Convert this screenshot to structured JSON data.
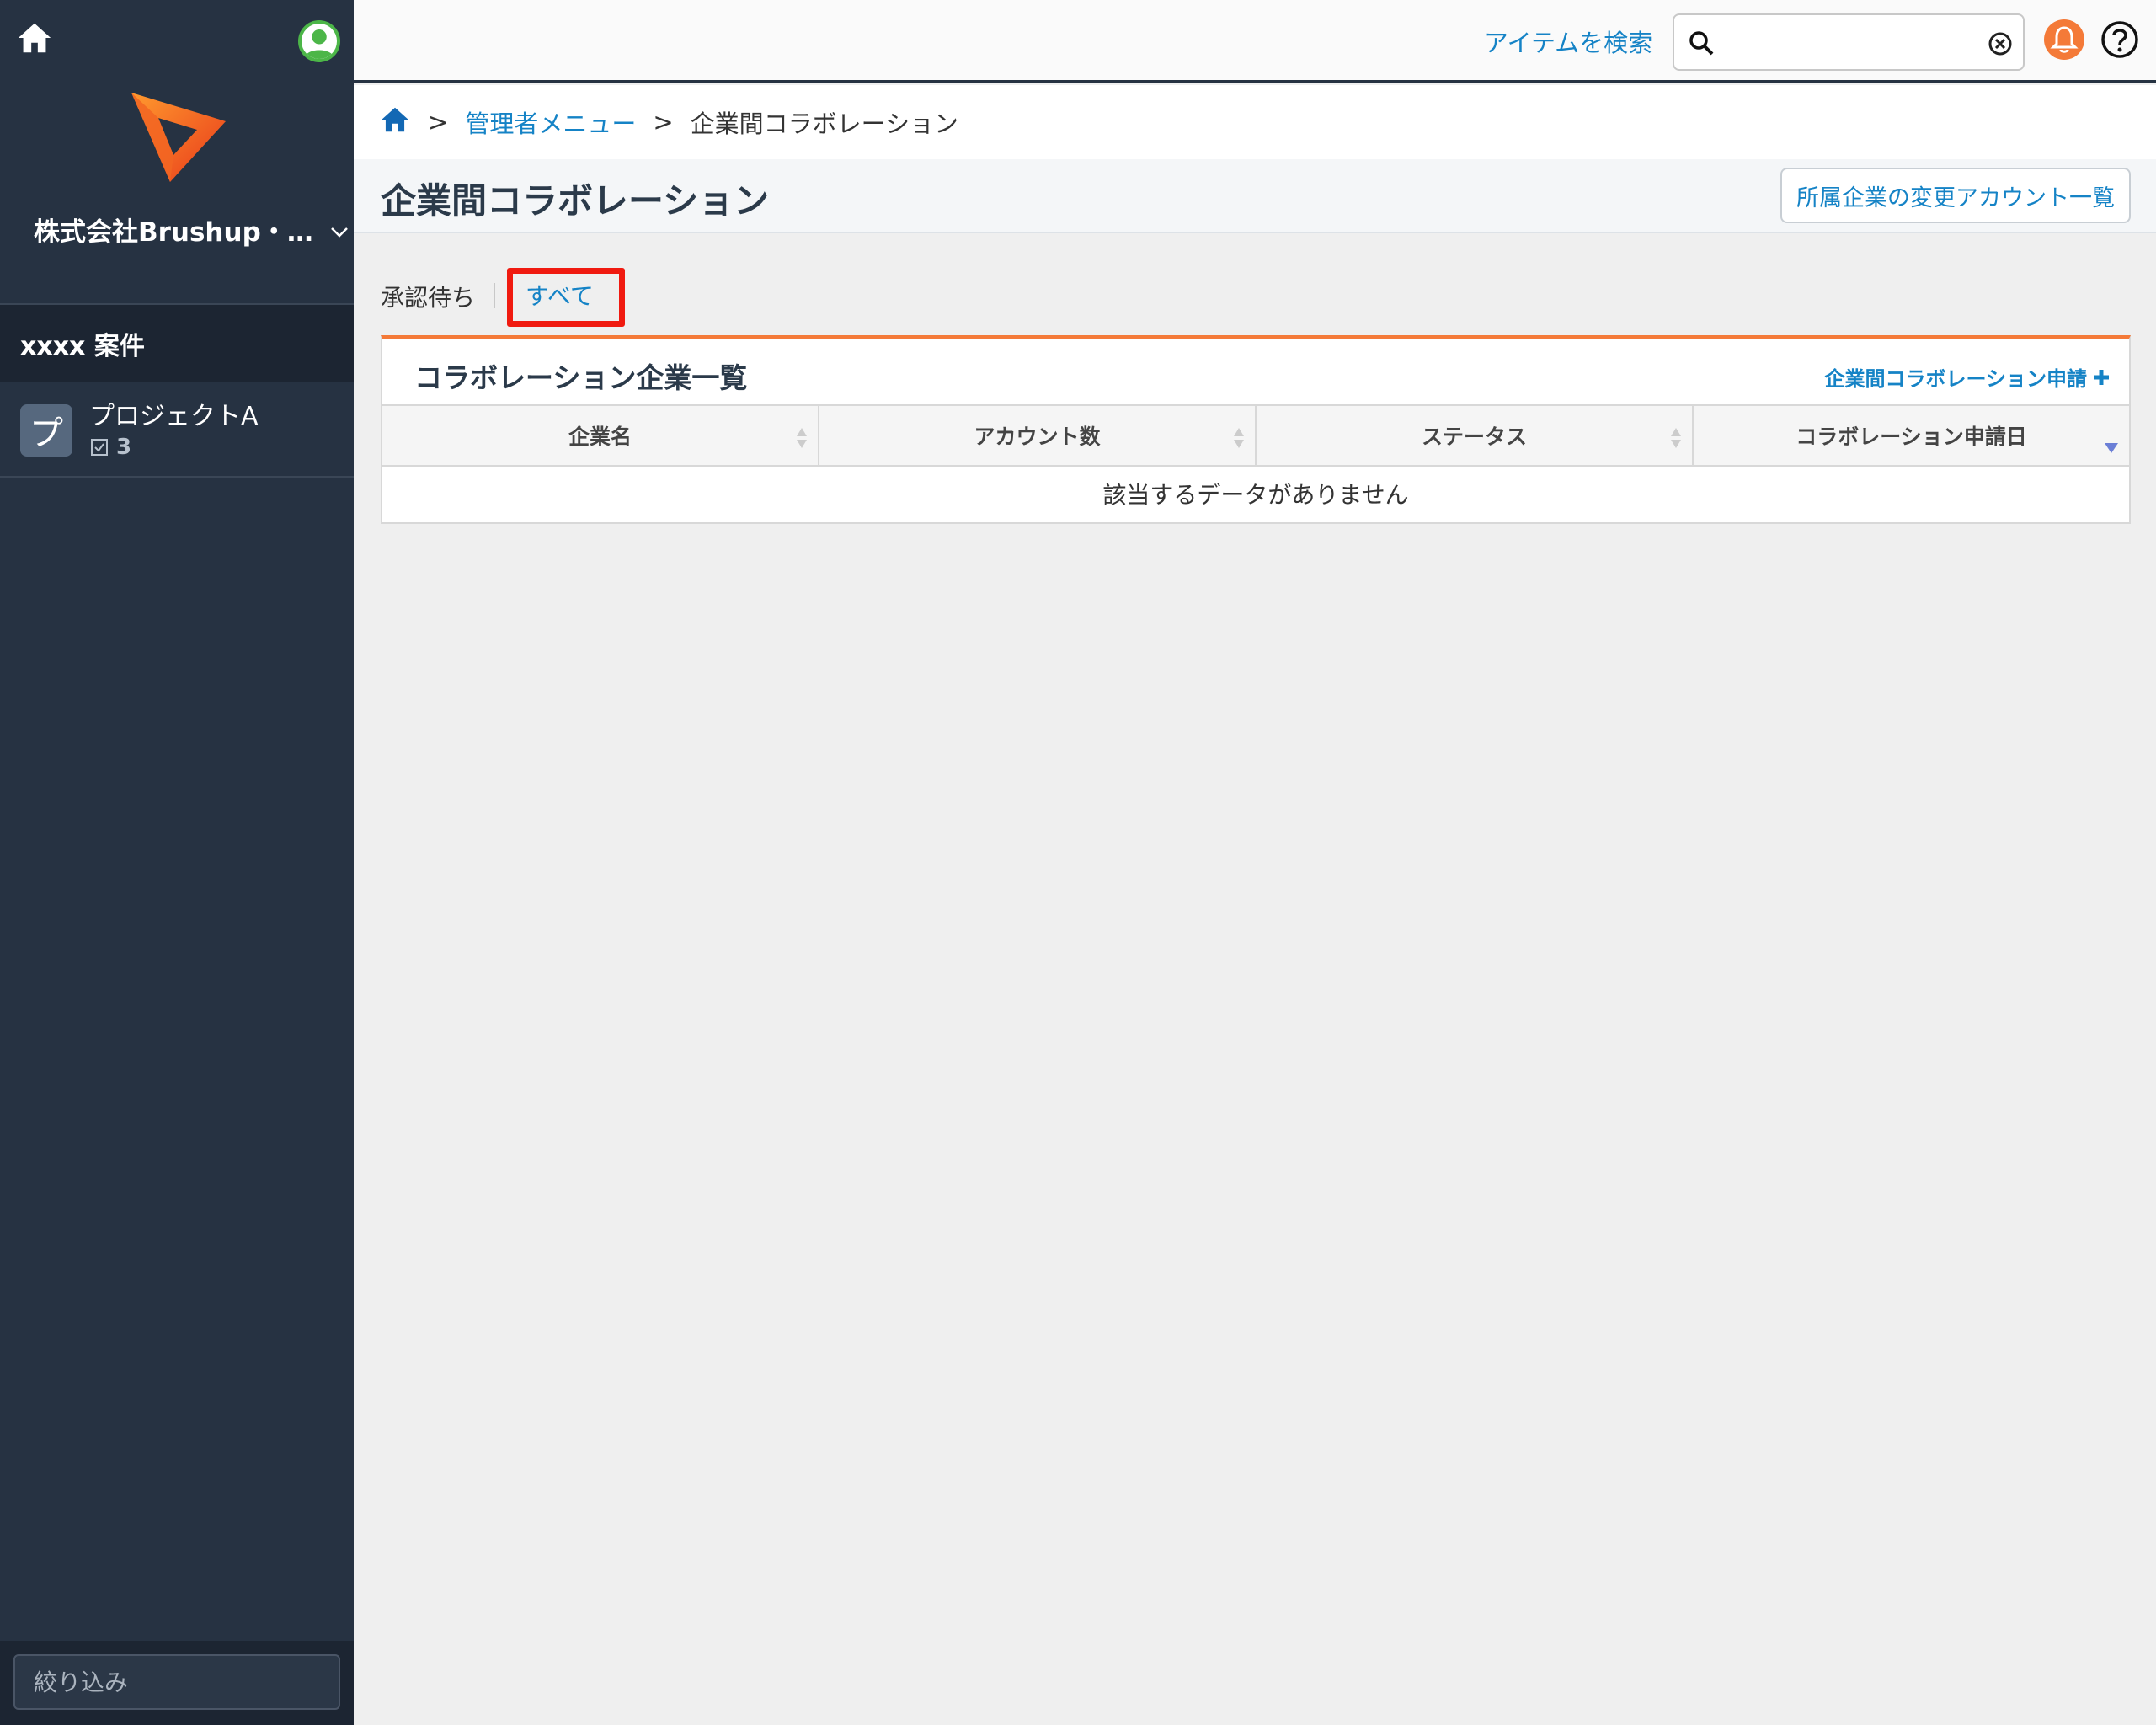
{
  "colors": {
    "sidebar_bg": "#263242",
    "accent_blue": "#1583c6",
    "accent_orange": "#f47a38",
    "highlight_red": "#f01a10"
  },
  "sidebar": {
    "home_icon": "home-icon",
    "avatar_icon": "user-avatar-icon",
    "company_name": "株式会社Brushup・…",
    "section_title": "xxxx 案件",
    "project": {
      "initial": "プ",
      "name": "プロジェクトA",
      "task_count": "3"
    },
    "filter_placeholder": "絞り込み"
  },
  "header": {
    "search_label": "アイテムを検索",
    "search_value": "",
    "search_icon": "search-icon",
    "clear_icon": "clear-icon",
    "bell_icon": "bell-icon",
    "help_icon": "help-icon"
  },
  "breadcrumb": {
    "home_icon": "home-icon",
    "items": [
      "管理者メニュー",
      "企業間コラボレーション"
    ],
    "separator": ">"
  },
  "page": {
    "title": "企業間コラボレーション",
    "account_list_button": "所属企業の変更アカウント一覧"
  },
  "filter_tabs": {
    "pending": "承認待ち",
    "all": "すべて",
    "selected": "すべて"
  },
  "panel": {
    "title": "コラボレーション企業一覧",
    "action_label": "企業間コラボレーション申請",
    "columns": [
      "企業名",
      "アカウント数",
      "ステータス",
      "コラボレーション申請日"
    ],
    "sorted_column": "コラボレーション申請日",
    "empty_message": "該当するデータがありません"
  }
}
